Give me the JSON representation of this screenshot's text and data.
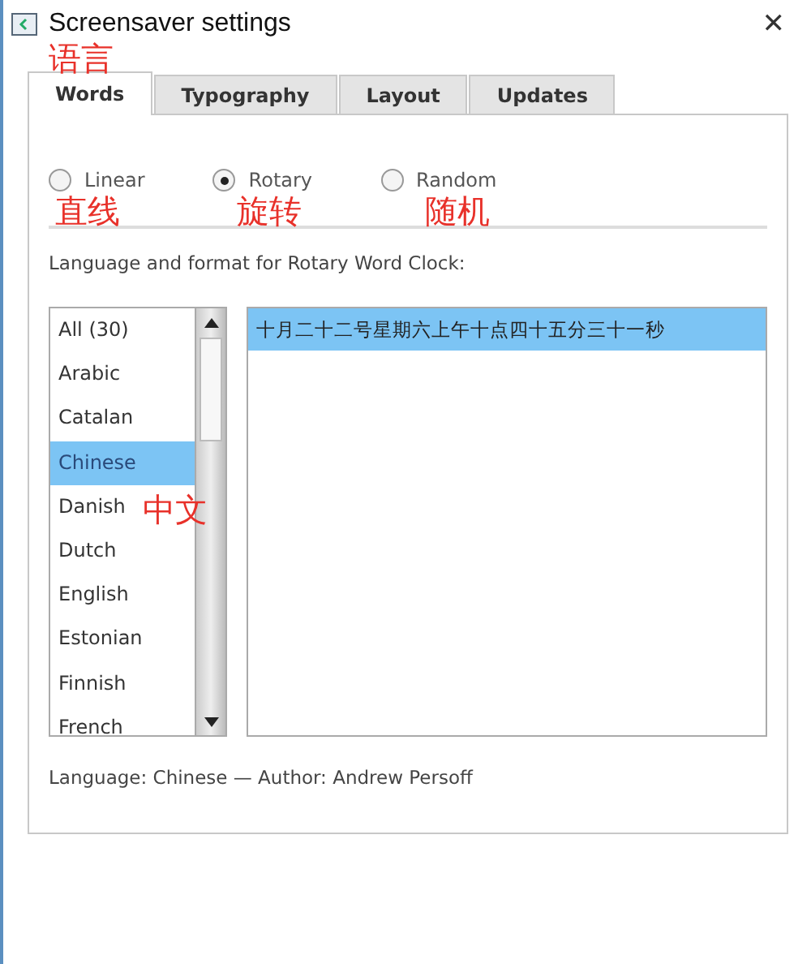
{
  "window": {
    "title": "Screensaver settings",
    "close": "✕"
  },
  "tabs": [
    {
      "label": "Words",
      "selected": true
    },
    {
      "label": "Typography",
      "selected": false
    },
    {
      "label": "Layout",
      "selected": false
    },
    {
      "label": "Updates",
      "selected": false
    }
  ],
  "modes": [
    {
      "label": "Linear",
      "selected": false
    },
    {
      "label": "Rotary",
      "selected": true
    },
    {
      "label": "Random",
      "selected": false
    }
  ],
  "format_label": "Language and format for Rotary Word Clock:",
  "languages": [
    {
      "label": "All (30)",
      "selected": false
    },
    {
      "label": "Arabic",
      "selected": false
    },
    {
      "label": "Catalan",
      "selected": false
    },
    {
      "label": "Chinese",
      "selected": true
    },
    {
      "label": "Danish",
      "selected": false
    },
    {
      "label": "Dutch",
      "selected": false
    },
    {
      "label": "English",
      "selected": false
    },
    {
      "label": "Estonian",
      "selected": false
    },
    {
      "label": "Finnish",
      "selected": false
    },
    {
      "label": "French",
      "selected": false
    }
  ],
  "formats": [
    {
      "label": "十月二十二号星期六上午十点四十五分三十一秒",
      "selected": true
    }
  ],
  "footer": "Language: Chinese — Author: Andrew Persoff",
  "annotations": [
    "语言",
    "直线",
    "旋转",
    "随机",
    "中文"
  ]
}
